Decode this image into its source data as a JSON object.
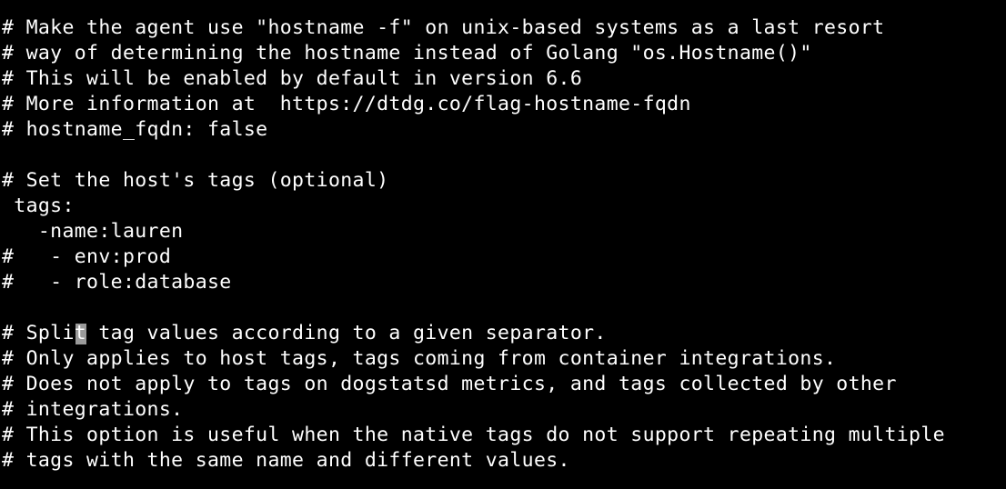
{
  "terminal": {
    "background": "#000000",
    "foreground": "#ffffff",
    "cursor_color": "#9a9a9a",
    "lines": [
      "# Make the agent use \"hostname -f\" on unix-based systems as a last resort",
      "# way of determining the hostname instead of Golang \"os.Hostname()\"",
      "# This will be enabled by default in version 6.6",
      "# More information at  https://dtdg.co/flag-hostname-fqdn",
      "# hostname_fqdn: false",
      "",
      "# Set the host's tags (optional)",
      " tags:",
      "   -name:lauren",
      "#   - env:prod",
      "#   - role:database",
      "",
      "# Split tag values according to a given separator.",
      "# Only applies to host tags, tags coming from container integrations.",
      "# Does not apply to tags on dogstatsd metrics, and tags collected by other",
      "# integrations.",
      "# This option is useful when the native tags do not support repeating multiple",
      "# tags with the same name and different values."
    ],
    "cursor_line": 11
  }
}
